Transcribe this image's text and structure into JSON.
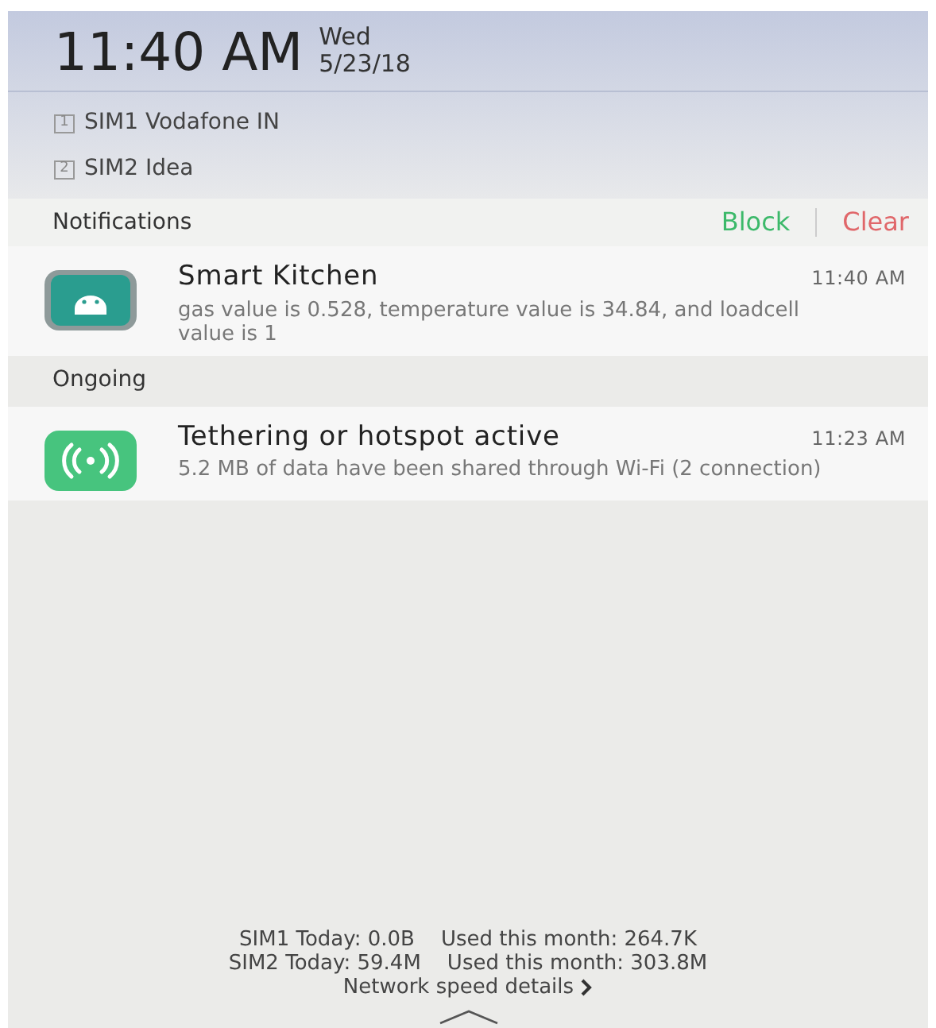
{
  "header": {
    "time": "11:40 AM",
    "day": "Wed",
    "date": "5/23/18"
  },
  "sims": [
    {
      "badge": "1",
      "name": "SIM1 Vodafone IN"
    },
    {
      "badge": "2",
      "name": "SIM2 Idea"
    }
  ],
  "notifications_header": {
    "title": "Notifications",
    "actions": [
      {
        "label": "Block",
        "color": "#3cb96a"
      },
      {
        "label": "Clear",
        "color": "#e0676a"
      }
    ]
  },
  "notifications": [
    {
      "kind": "android",
      "title": "Smart Kitchen",
      "time": "11:40 AM",
      "text": "gas value is 0.528, temperature value is 34.84, and loadcell value is 1"
    }
  ],
  "ongoing": {
    "title": "Ongoing",
    "items": [
      {
        "kind": "hotspot",
        "title": "Tethering or hotspot active",
        "time": "11:23 AM",
        "text": "5.2 MB of data have been shared through Wi-Fi (2 connection)"
      }
    ]
  },
  "footer": {
    "lines": [
      "SIM1 Today: 0.0B    Used this month: 264.7K",
      "SIM2 Today: 59.4M    Used this month: 303.8M"
    ],
    "link": "Network speed details"
  }
}
